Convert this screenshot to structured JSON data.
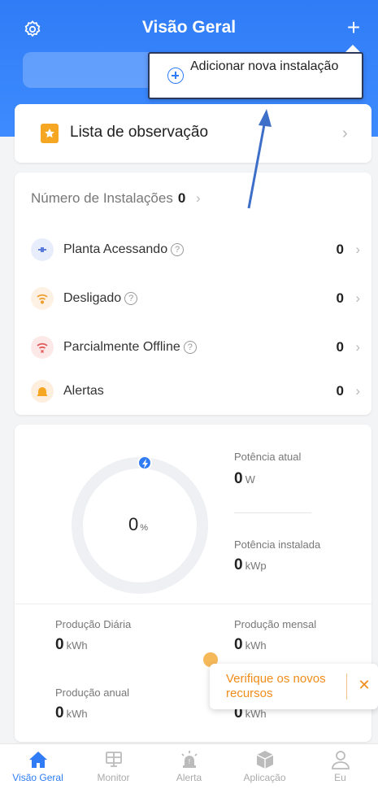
{
  "header": {
    "title": "Visão Geral"
  },
  "popup": {
    "label": "Adicionar nova instalação"
  },
  "watchlist": {
    "label": "Lista de observação"
  },
  "installations": {
    "title": "Número de Instalações",
    "count": "0",
    "rows": [
      {
        "label": "Planta Acessando",
        "value": "0",
        "has_help": true
      },
      {
        "label": "Desligado",
        "value": "0",
        "has_help": true
      },
      {
        "label": "Parcialmente Offline",
        "value": "0",
        "has_help": true
      },
      {
        "label": "Alertas",
        "value": "0",
        "has_help": false
      }
    ]
  },
  "stats": {
    "ring_value": "0",
    "ring_unit": "%",
    "current_power": {
      "label": "Potência atual",
      "value": "0",
      "unit": "W"
    },
    "installed_power": {
      "label": "Potência instalada",
      "value": "0",
      "unit": "kWp"
    },
    "daily": {
      "label": "Produção Diária",
      "value": "0",
      "unit": "kWh"
    },
    "monthly": {
      "label": "Produção mensal",
      "value": "0",
      "unit": "kWh"
    },
    "annual": {
      "label": "Produção anual",
      "value": "0",
      "unit": "kWh"
    },
    "total": {
      "value": "0",
      "unit": "kWh"
    }
  },
  "toast": {
    "text": "Verifique os novos recursos",
    "close": "✕"
  },
  "tabs": [
    {
      "label": "Visão Geral",
      "icon": "home-icon",
      "active": true
    },
    {
      "label": "Monitor",
      "icon": "monitor-icon",
      "active": false
    },
    {
      "label": "Alerta",
      "icon": "alarm-icon",
      "active": false
    },
    {
      "label": "Aplicação",
      "icon": "cube-icon",
      "active": false
    },
    {
      "label": "Eu",
      "icon": "user-icon",
      "active": false
    }
  ],
  "colors": {
    "primary": "#2f7cf6",
    "warning": "#f08c1a",
    "watch": "#f5a623"
  }
}
